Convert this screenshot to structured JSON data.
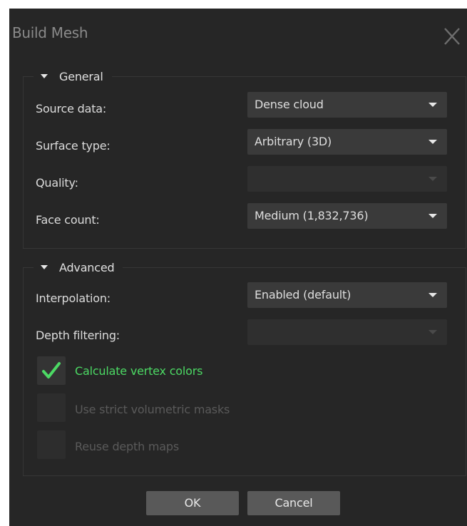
{
  "dialog": {
    "title": "Build Mesh",
    "close_icon": "close-icon"
  },
  "general": {
    "title": "General",
    "rows": [
      {
        "label": "Source data:",
        "value": "Dense cloud",
        "enabled": true
      },
      {
        "label": "Surface type:",
        "value": "Arbitrary (3D)",
        "enabled": true
      },
      {
        "label": "Quality:",
        "value": "",
        "enabled": false
      },
      {
        "label": "Face count:",
        "value": "Medium (1,832,736)",
        "enabled": true
      }
    ]
  },
  "advanced": {
    "title": "Advanced",
    "rows": [
      {
        "label": "Interpolation:",
        "value": "Enabled (default)",
        "enabled": true
      },
      {
        "label": "Depth filtering:",
        "value": "",
        "enabled": false
      }
    ],
    "checkboxes": [
      {
        "label": "Calculate vertex colors",
        "checked": true,
        "enabled": true
      },
      {
        "label": "Use strict volumetric masks",
        "checked": false,
        "enabled": false
      },
      {
        "label": "Reuse depth maps",
        "checked": false,
        "enabled": false
      }
    ]
  },
  "buttons": {
    "ok": "OK",
    "cancel": "Cancel"
  },
  "colors": {
    "background": "#262626",
    "accent_checked": "#4cd964",
    "button": "#595959"
  }
}
